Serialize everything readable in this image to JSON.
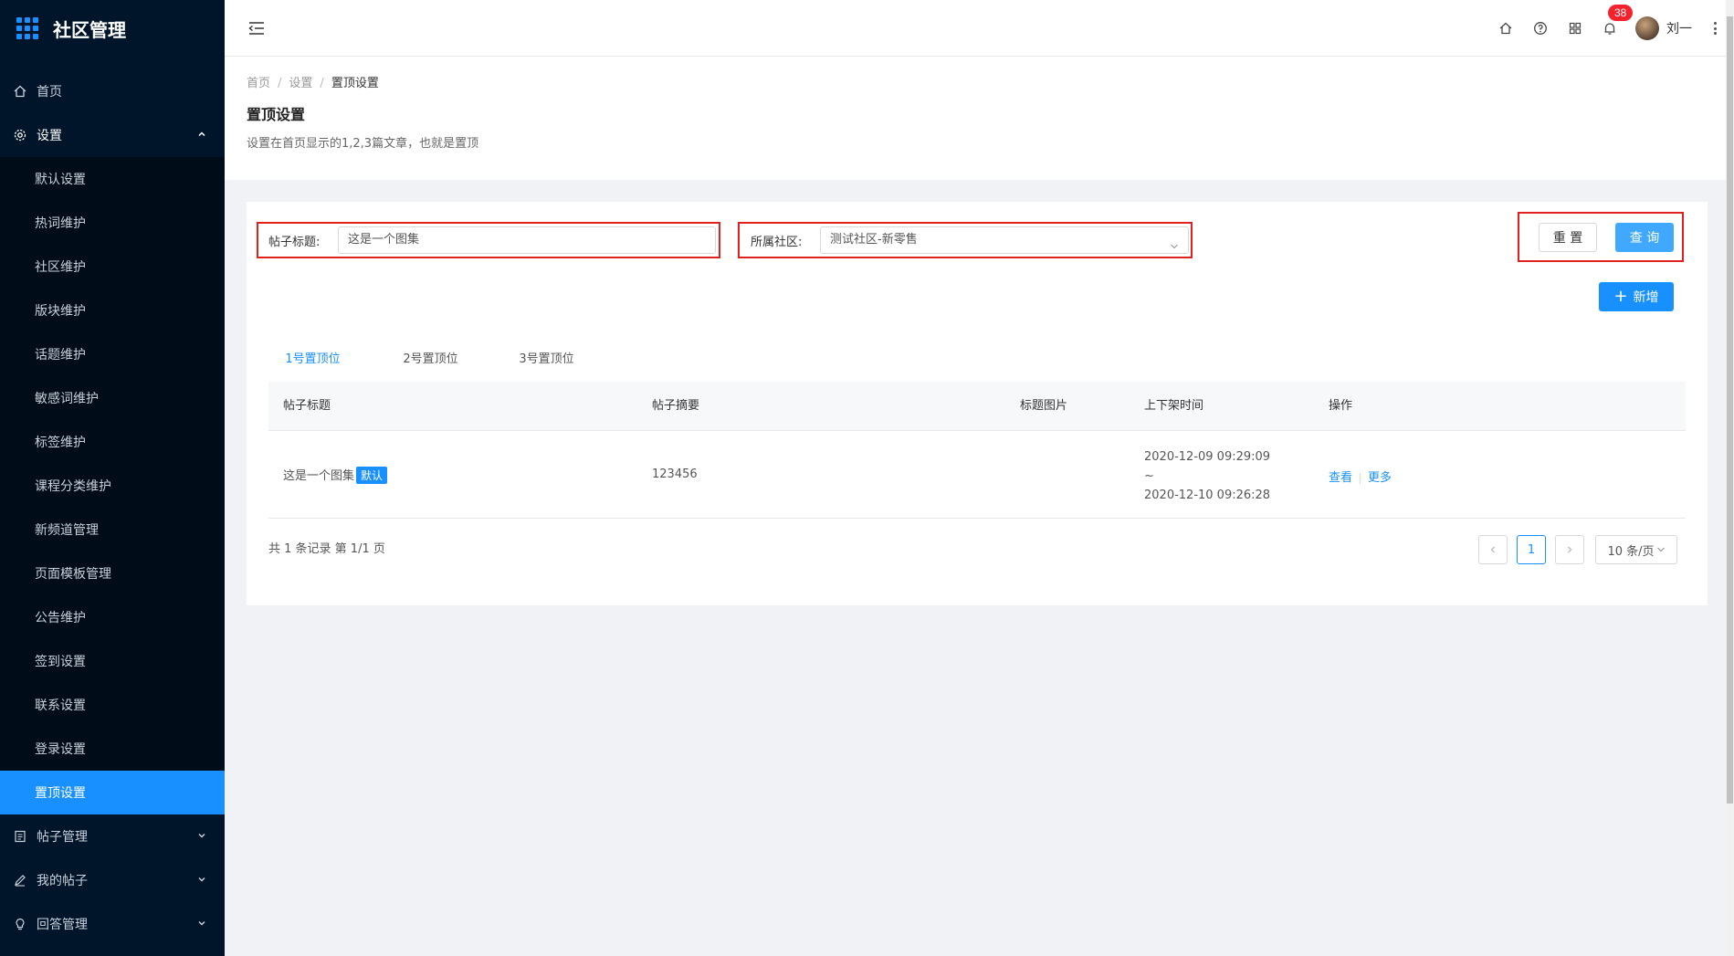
{
  "app": {
    "title": "社区管理"
  },
  "sidebar": {
    "home": "首页",
    "settings": "设置",
    "settings_items": [
      "默认设置",
      "热词维护",
      "社区维护",
      "版块维护",
      "话题维护",
      "敏感词维护",
      "标签维护",
      "课程分类维护",
      "新频道管理",
      "页面模板管理",
      "公告维护",
      "签到设置",
      "联系设置",
      "登录设置",
      "置顶设置"
    ],
    "posts_mgmt": "帖子管理",
    "my_posts": "我的帖子",
    "answers_mgmt": "回答管理"
  },
  "header": {
    "notification_count": "38",
    "username": "刘一",
    "icons": [
      "menu-fold-icon",
      "home-icon",
      "question-icon",
      "apps-icon",
      "bell-icon",
      "more-vertical-icon"
    ]
  },
  "page": {
    "breadcrumb": [
      "首页",
      "设置",
      "置顶设置"
    ],
    "title": "置顶设置",
    "description": "设置在首页显示的1,2,3篇文章，也就是置顶"
  },
  "filters": {
    "title_label": "帖子标题:",
    "title_value": "这是一个图集",
    "community_label": "所属社区:",
    "community_value": "测试社区-新零售",
    "reset": "重 置",
    "query": "查 询",
    "add": "新增"
  },
  "tabs": [
    "1号置顶位",
    "2号置顶位",
    "3号置顶位"
  ],
  "table": {
    "columns": [
      "帖子标题",
      "帖子摘要",
      "标题图片",
      "上下架时间",
      "操作"
    ],
    "rows": [
      {
        "title": "这是一个图集",
        "tag": "默认",
        "summary": "123456",
        "image": "",
        "time_start": "2020-12-09 09:29:09",
        "time_sep": "~",
        "time_end": "2020-12-10 09:26:28",
        "action_view": "查看",
        "action_more": "更多"
      }
    ]
  },
  "pagination": {
    "summary": "共 1 条记录 第 1/1 页",
    "current_page": "1",
    "page_size": "10 条/页"
  },
  "colors": {
    "accent": "#1890ff",
    "sidebar_bg": "#001529",
    "highlight_border": "#e0211f",
    "badge": "#f5222d"
  }
}
